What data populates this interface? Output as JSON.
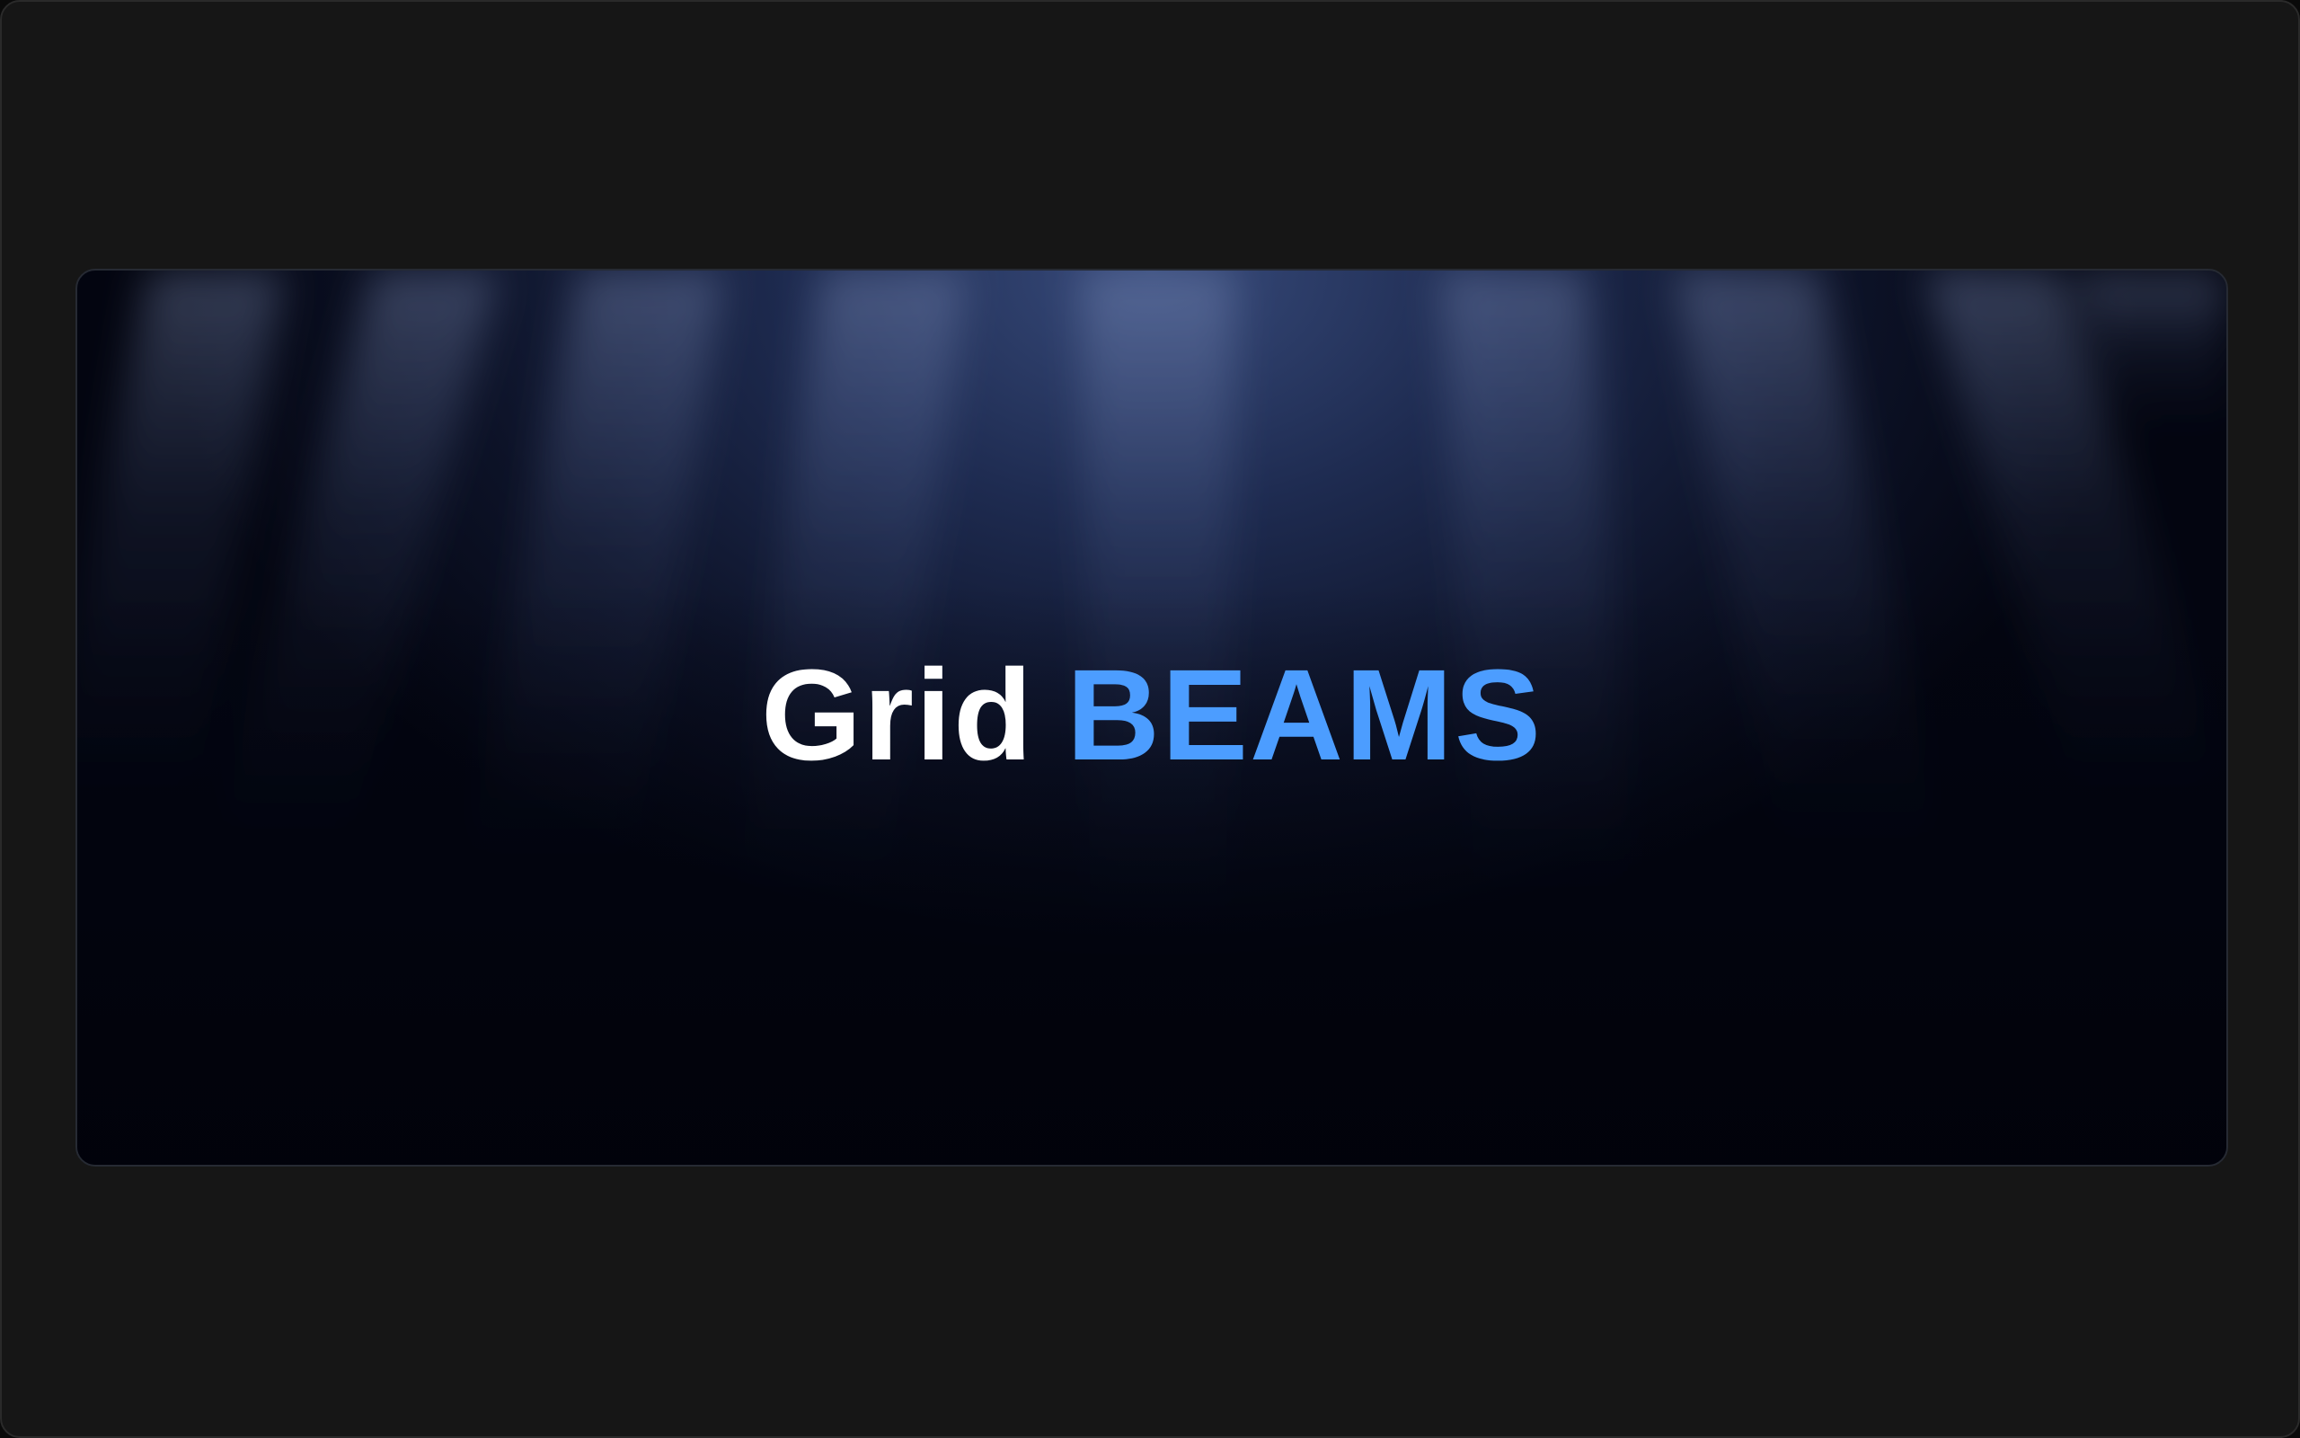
{
  "headline": {
    "prefix": "Grid",
    "highlight": "BEAMS"
  },
  "colors": {
    "page_background": "#161616",
    "card_background": "#02040f",
    "beam_glow": "#3a4e80",
    "prefix_text": "#ffffff",
    "highlight_text": "#4c9dff"
  }
}
